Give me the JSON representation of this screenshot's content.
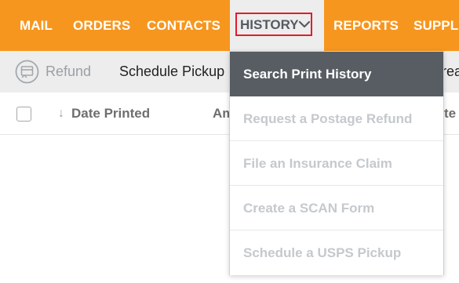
{
  "topnav": {
    "items": [
      {
        "id": "mail",
        "label": "MAIL"
      },
      {
        "id": "orders",
        "label": "ORDERS"
      },
      {
        "id": "contacts",
        "label": "CONTACTS"
      },
      {
        "id": "history",
        "label": "HISTORY"
      },
      {
        "id": "reports",
        "label": "REPORTS"
      },
      {
        "id": "supplies",
        "label": "SUPPLI"
      }
    ],
    "active": "HISTORY",
    "background_color": "#f7961e",
    "highlight_border_color": "#e41b2b"
  },
  "toolbar": {
    "refund_label": "Refund",
    "refund_icon": "refund-icon",
    "schedule_pickup_label": "Schedule Pickup",
    "truncated_label": "rea"
  },
  "table": {
    "sort_indicator": "↓",
    "columns": [
      "Date Printed",
      "Am",
      "te"
    ]
  },
  "history_menu": {
    "items": [
      {
        "label": "Search Print History",
        "state": "active"
      },
      {
        "label": "Request a Postage Refund",
        "state": "disabled"
      },
      {
        "label": "File an Insurance Claim",
        "state": "disabled"
      },
      {
        "label": "Create a SCAN Form",
        "state": "disabled"
      },
      {
        "label": "Schedule a USPS Pickup",
        "state": "disabled"
      }
    ],
    "active_background": "#575d63"
  }
}
